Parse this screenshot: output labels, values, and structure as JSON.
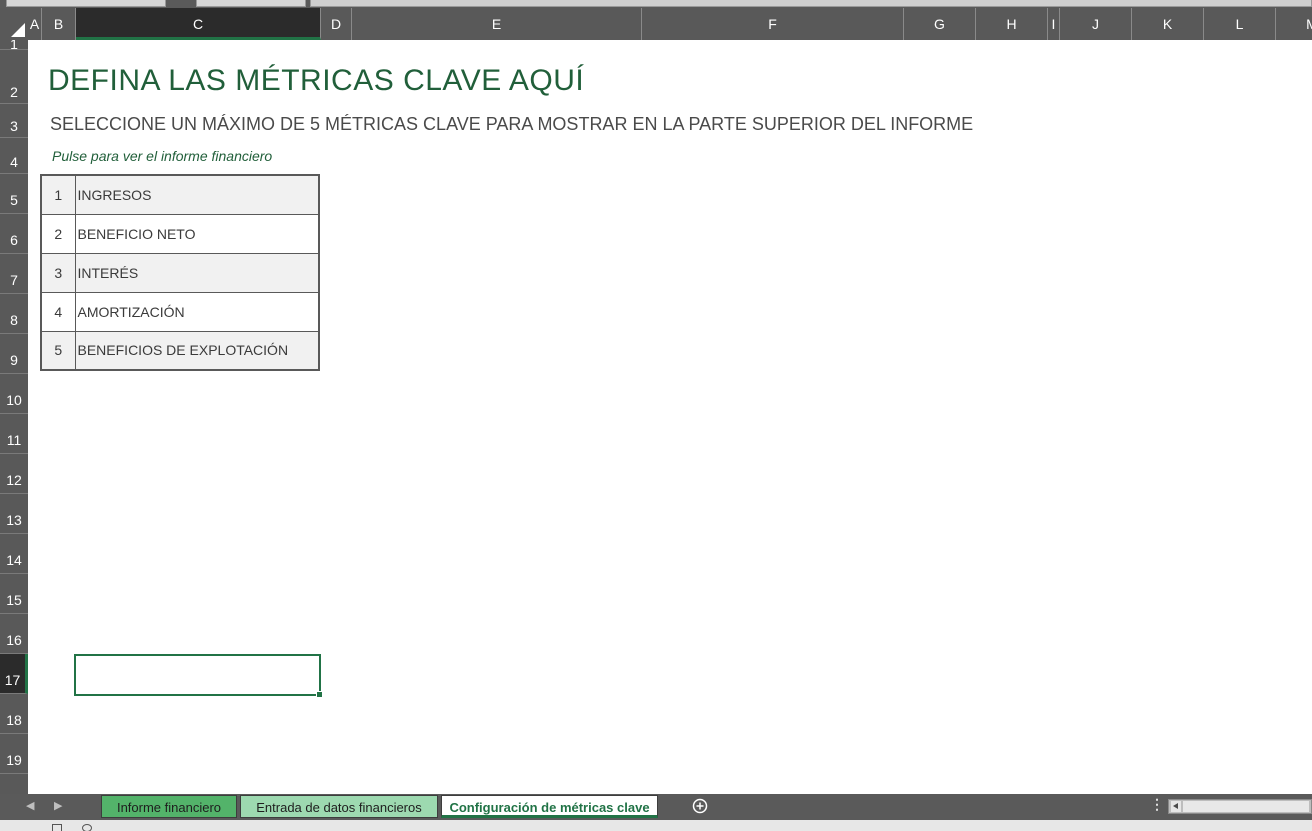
{
  "columns": [
    "A",
    "B",
    "C",
    "D",
    "E",
    "F",
    "G",
    "H",
    "I",
    "J",
    "K",
    "L",
    "M"
  ],
  "selected_column": "C",
  "rows": [
    "1",
    "2",
    "3",
    "4",
    "5",
    "6",
    "7",
    "8",
    "9",
    "10",
    "11",
    "12",
    "13",
    "14",
    "15",
    "16",
    "17",
    "18",
    "19"
  ],
  "selected_row": "17",
  "sheet": {
    "title": "DEFINA LAS MÉTRICAS CLAVE AQUÍ",
    "subtitle": "SELECCIONE UN MÁXIMO DE 5 MÉTRICAS CLAVE PARA MOSTRAR EN LA PARTE SUPERIOR DEL INFORME",
    "link_text": "Pulse para ver el informe financiero",
    "metrics": [
      {
        "number": "1",
        "label": "INGRESOS"
      },
      {
        "number": "2",
        "label": "BENEFICIO NETO"
      },
      {
        "number": "3",
        "label": "INTERÉS"
      },
      {
        "number": "4",
        "label": "AMORTIZACIÓN"
      },
      {
        "number": "5",
        "label": "BENEFICIOS DE EXPLOTACIÓN"
      }
    ]
  },
  "tabs": {
    "tab1": "Informe financiero",
    "tab2": "Entrada de datos financieros",
    "tab3": "Configuración de métricas clave",
    "active": "Configuración de métricas clave"
  },
  "colors": {
    "accent_green": "#217346",
    "title_green": "#215f3a",
    "tab1_green": "#53b36a",
    "tab2_green": "#9dd9b0",
    "header_gray": "#595959"
  },
  "icons": {
    "corner": "select-all-triangle-icon",
    "add_sheet": "plus-circle-icon",
    "prev": "caret-left-icon",
    "next": "caret-right-icon"
  }
}
